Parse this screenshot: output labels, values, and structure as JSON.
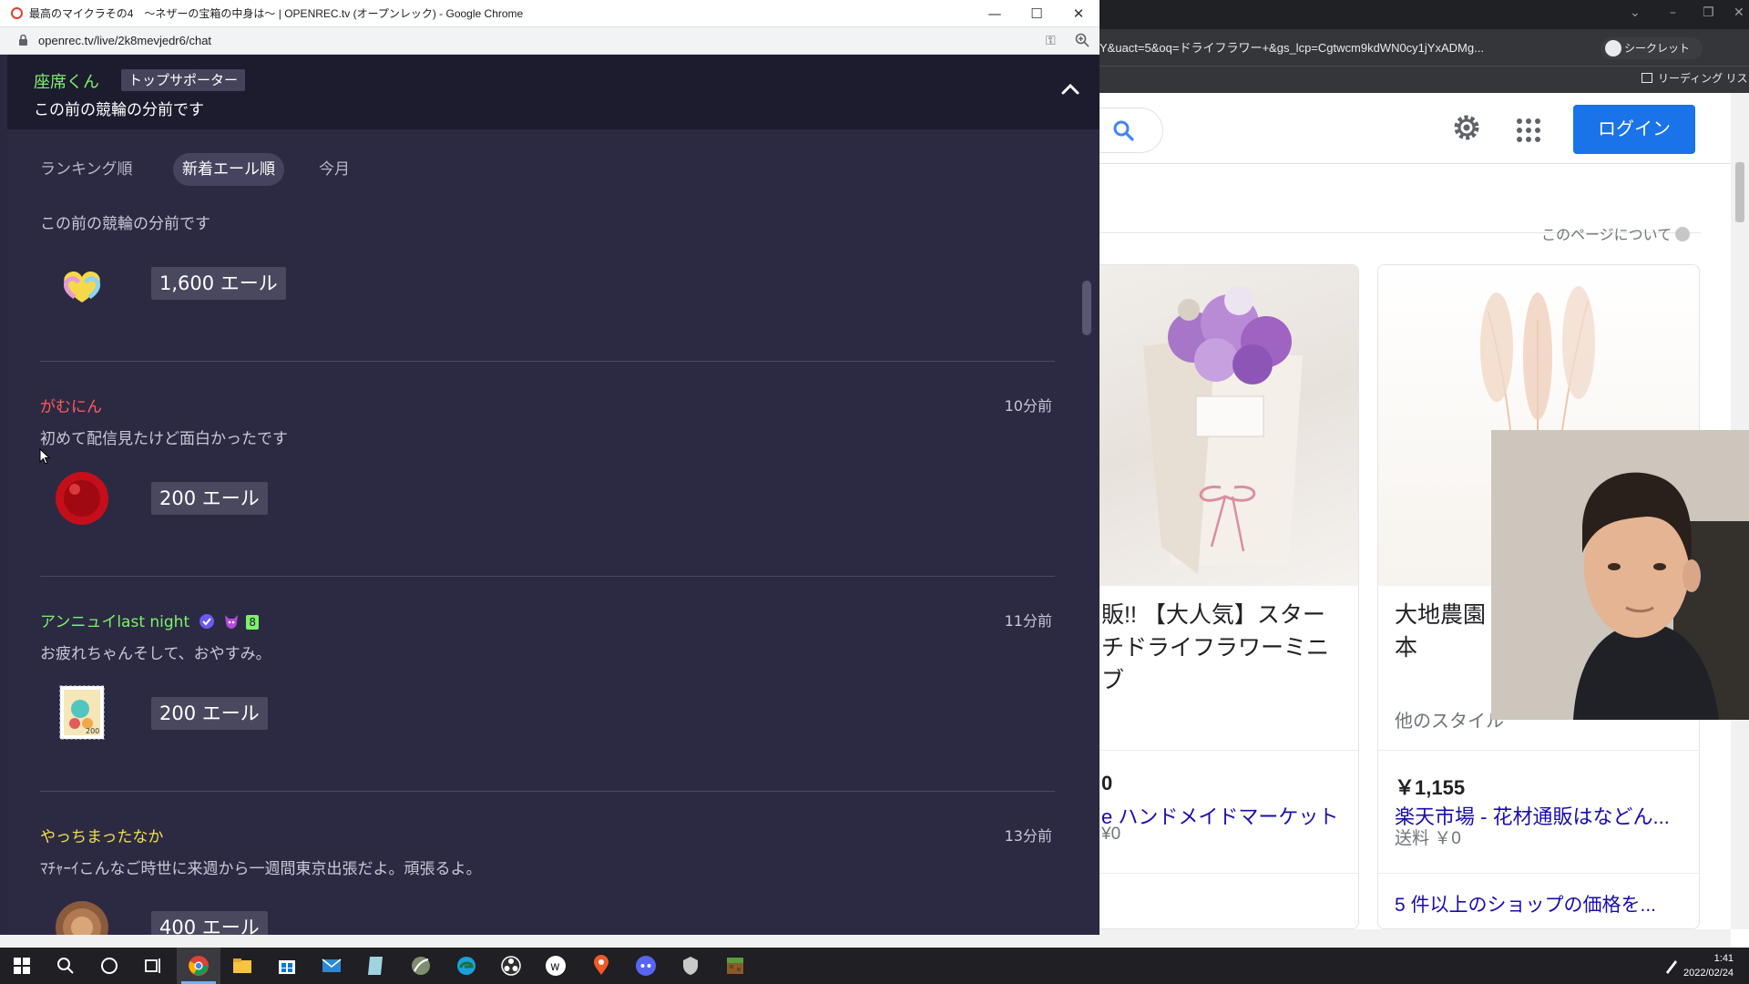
{
  "foreground_window": {
    "title": "最高のマイクラその4　～ネザーの宝箱の中身は～ | OPENREC.tv (オープンレック) - Google Chrome",
    "url": "openrec.tv/live/2k8mevjedr6/chat",
    "controls": {
      "minimize": "—",
      "maximize": "☐",
      "close": "✕"
    }
  },
  "pinned_message": {
    "user": "座席くん",
    "badge": "トップサポーター",
    "text": "この前の競輪の分前です"
  },
  "sort_tabs": [
    {
      "label": "ランキング順",
      "active": false
    },
    {
      "label": "新着エール順",
      "active": true
    },
    {
      "label": "今月",
      "active": false
    }
  ],
  "yells": [
    {
      "user": "",
      "user_color": "#7ef06d",
      "time": "",
      "message": "この前の競輪の分前です",
      "amount": "1,600 エール",
      "stamp": "heart-gold-stamp"
    },
    {
      "user": "がむにん",
      "user_color": "#ff5b5b",
      "time": "10分前",
      "message": "初めて配信見たけど面白かったです",
      "amount": "200 エール",
      "stamp": "red-ball-stamp"
    },
    {
      "user": "アンニュイlast night",
      "user_color": "#7ef06d",
      "time": "11分前",
      "message": "お疲れちゃんそして、おやすみ。",
      "amount": "200 エール",
      "stamp": "bird-postage-stamp",
      "badges": [
        "verified-icon",
        "devil-icon",
        "level-badge"
      ],
      "level": "8"
    },
    {
      "user": "やっちまったなか",
      "user_color": "#f0e04a",
      "time": "13分前",
      "message": "ﾏﾁｬｰｲこんなご時世に来週から一週間東京出張だよ。頑張るよ。",
      "amount": "400 エール",
      "stamp": "bronze-coin-stamp"
    }
  ],
  "background_browser": {
    "url_fragment": "Y&uact=5&oq=ドライフラワー+&gs_lcp=Cgtwcm9kdWN0cy1jYxADMg...",
    "incognito_label": "シークレット (2)",
    "reading_list_label": "リーディング リスト",
    "login_button": "ログイン",
    "about_page": "このページについて",
    "cards": [
      {
        "title": "販!! 【大人気】スターチドライフラワーミニブ",
        "price": "0",
        "shop": "e ハンドメイドマーケット",
        "shipping": "¥0",
        "more": ""
      },
      {
        "title": "大地農園 ルームリー ュ 約5本",
        "subtitle": "他のスタイル",
        "price": "￥1,155",
        "shop": "楽天市場 - 花材通販はなどん...",
        "shipping": "送料 ￥0",
        "more": "5 件以上のショップの価格を..."
      }
    ]
  },
  "taskbar": {
    "time": "1:41",
    "date": "2022/02/24"
  },
  "colors": {
    "openrec_bg": "#2c2a43",
    "pinned_bg": "#1d1b2e",
    "google_blue": "#1a73e8"
  }
}
